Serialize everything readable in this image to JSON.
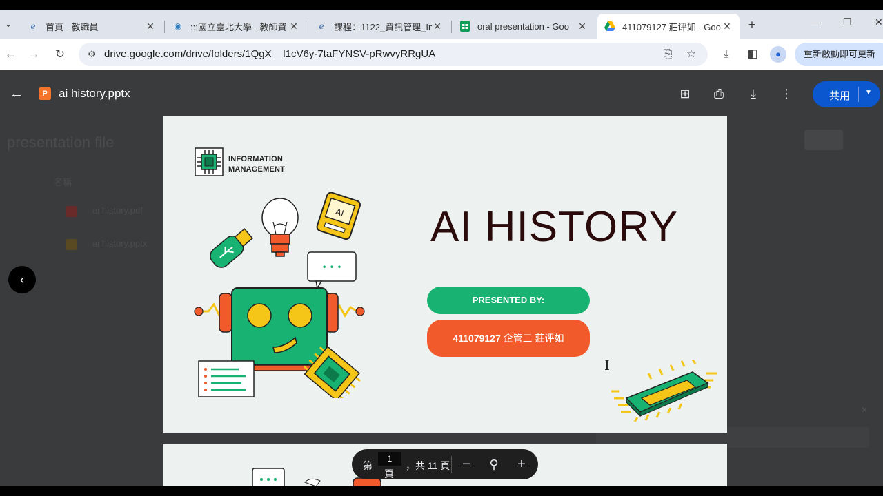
{
  "browser": {
    "tabs": [
      {
        "label": "首頁 - 教職員",
        "favicon": "e-learning-icon"
      },
      {
        "label": ":::國立臺北大學 - 教師資",
        "favicon": "ntpu-icon"
      },
      {
        "label": "課程：1122_資訊管理_In",
        "favicon": "e-learning-icon"
      },
      {
        "label": "oral presentation - Goo",
        "favicon": "sheets-icon"
      },
      {
        "label": "411079127 莊评如 - Goo",
        "favicon": "drive-icon",
        "active": true
      }
    ],
    "new_tab_symbol": "+",
    "url": "drive.google.com/drive/folders/1QgX__l1cV6y-7taFYNSV-pRwvyRRgUA_",
    "update_button": "重新啟動即可更新"
  },
  "background": {
    "folder_title": "presentation file",
    "column_header": "名稱",
    "files": [
      {
        "name": "ai history.pdf",
        "color": "#6b2a2a"
      },
      {
        "name": "ai history.pptx",
        "color": "#5a4a22"
      }
    ]
  },
  "viewer": {
    "file_icon_letter": "P",
    "file_name": "ai history.pptx",
    "share_label": "共用"
  },
  "slide": {
    "brand_line1": "INFORMATION",
    "brand_line2": "MANAGEMENT",
    "title": "AI HISTORY",
    "presented_by": "PRESENTED BY:",
    "presenter_id": "411079127",
    "presenter_name": " 企管三 莊评如",
    "ai_chip_label": "AI",
    "speech_dots": "• • •"
  },
  "pager": {
    "prefix": "第",
    "current_page": "1",
    "page_unit": "頁",
    "total_text": "，共 11 頁",
    "zoom_out": "−",
    "zoom_in": "+"
  },
  "colors": {
    "accent_green": "#18b272",
    "accent_orange": "#f15a2b",
    "share_blue": "#0b57d0"
  }
}
